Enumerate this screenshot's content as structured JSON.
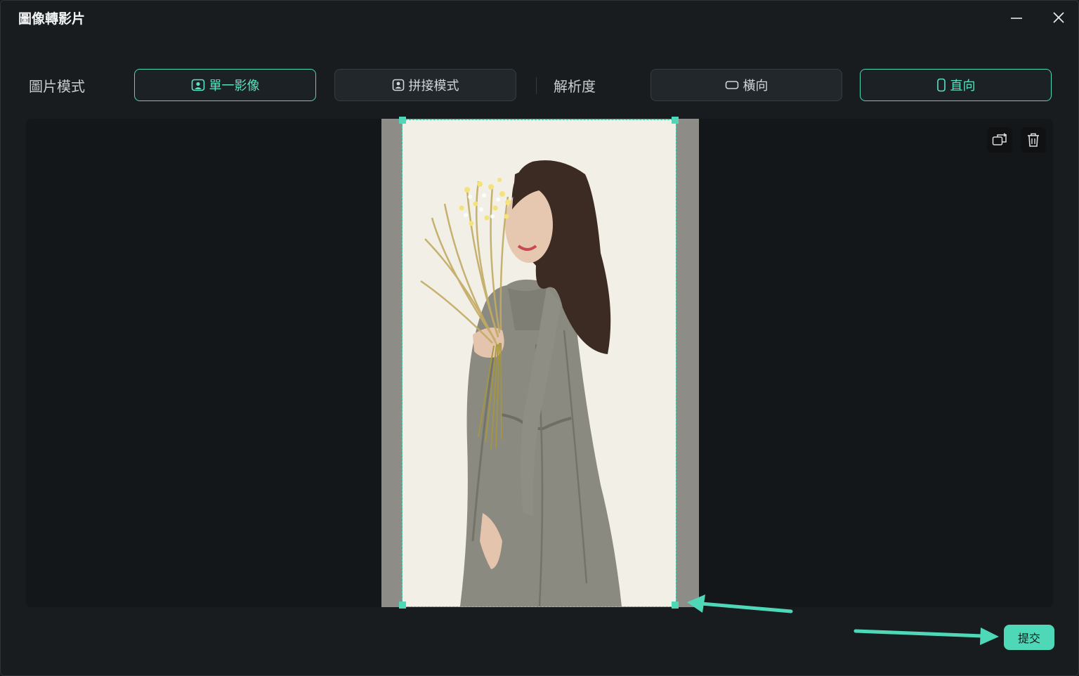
{
  "window": {
    "title": "圖像轉影片"
  },
  "toolbar": {
    "mode_label": "圖片模式",
    "single_label": "單一影像",
    "collage_label": "拼接模式",
    "resolution_label": "解析度",
    "landscape_label": "橫向",
    "portrait_label": "直向",
    "selected_mode": "單一影像",
    "selected_orientation": "直向"
  },
  "footer": {
    "submit_label": "提交"
  },
  "colors": {
    "accent": "#4fd8b8",
    "background": "#181c1f",
    "canvas": "#14171a",
    "photo_background": "#f1efe6"
  },
  "icons": [
    "minimize-icon",
    "close-icon",
    "single-image-icon",
    "collage-icon",
    "landscape-icon",
    "portrait-icon",
    "replace-image-icon",
    "trash-icon"
  ]
}
